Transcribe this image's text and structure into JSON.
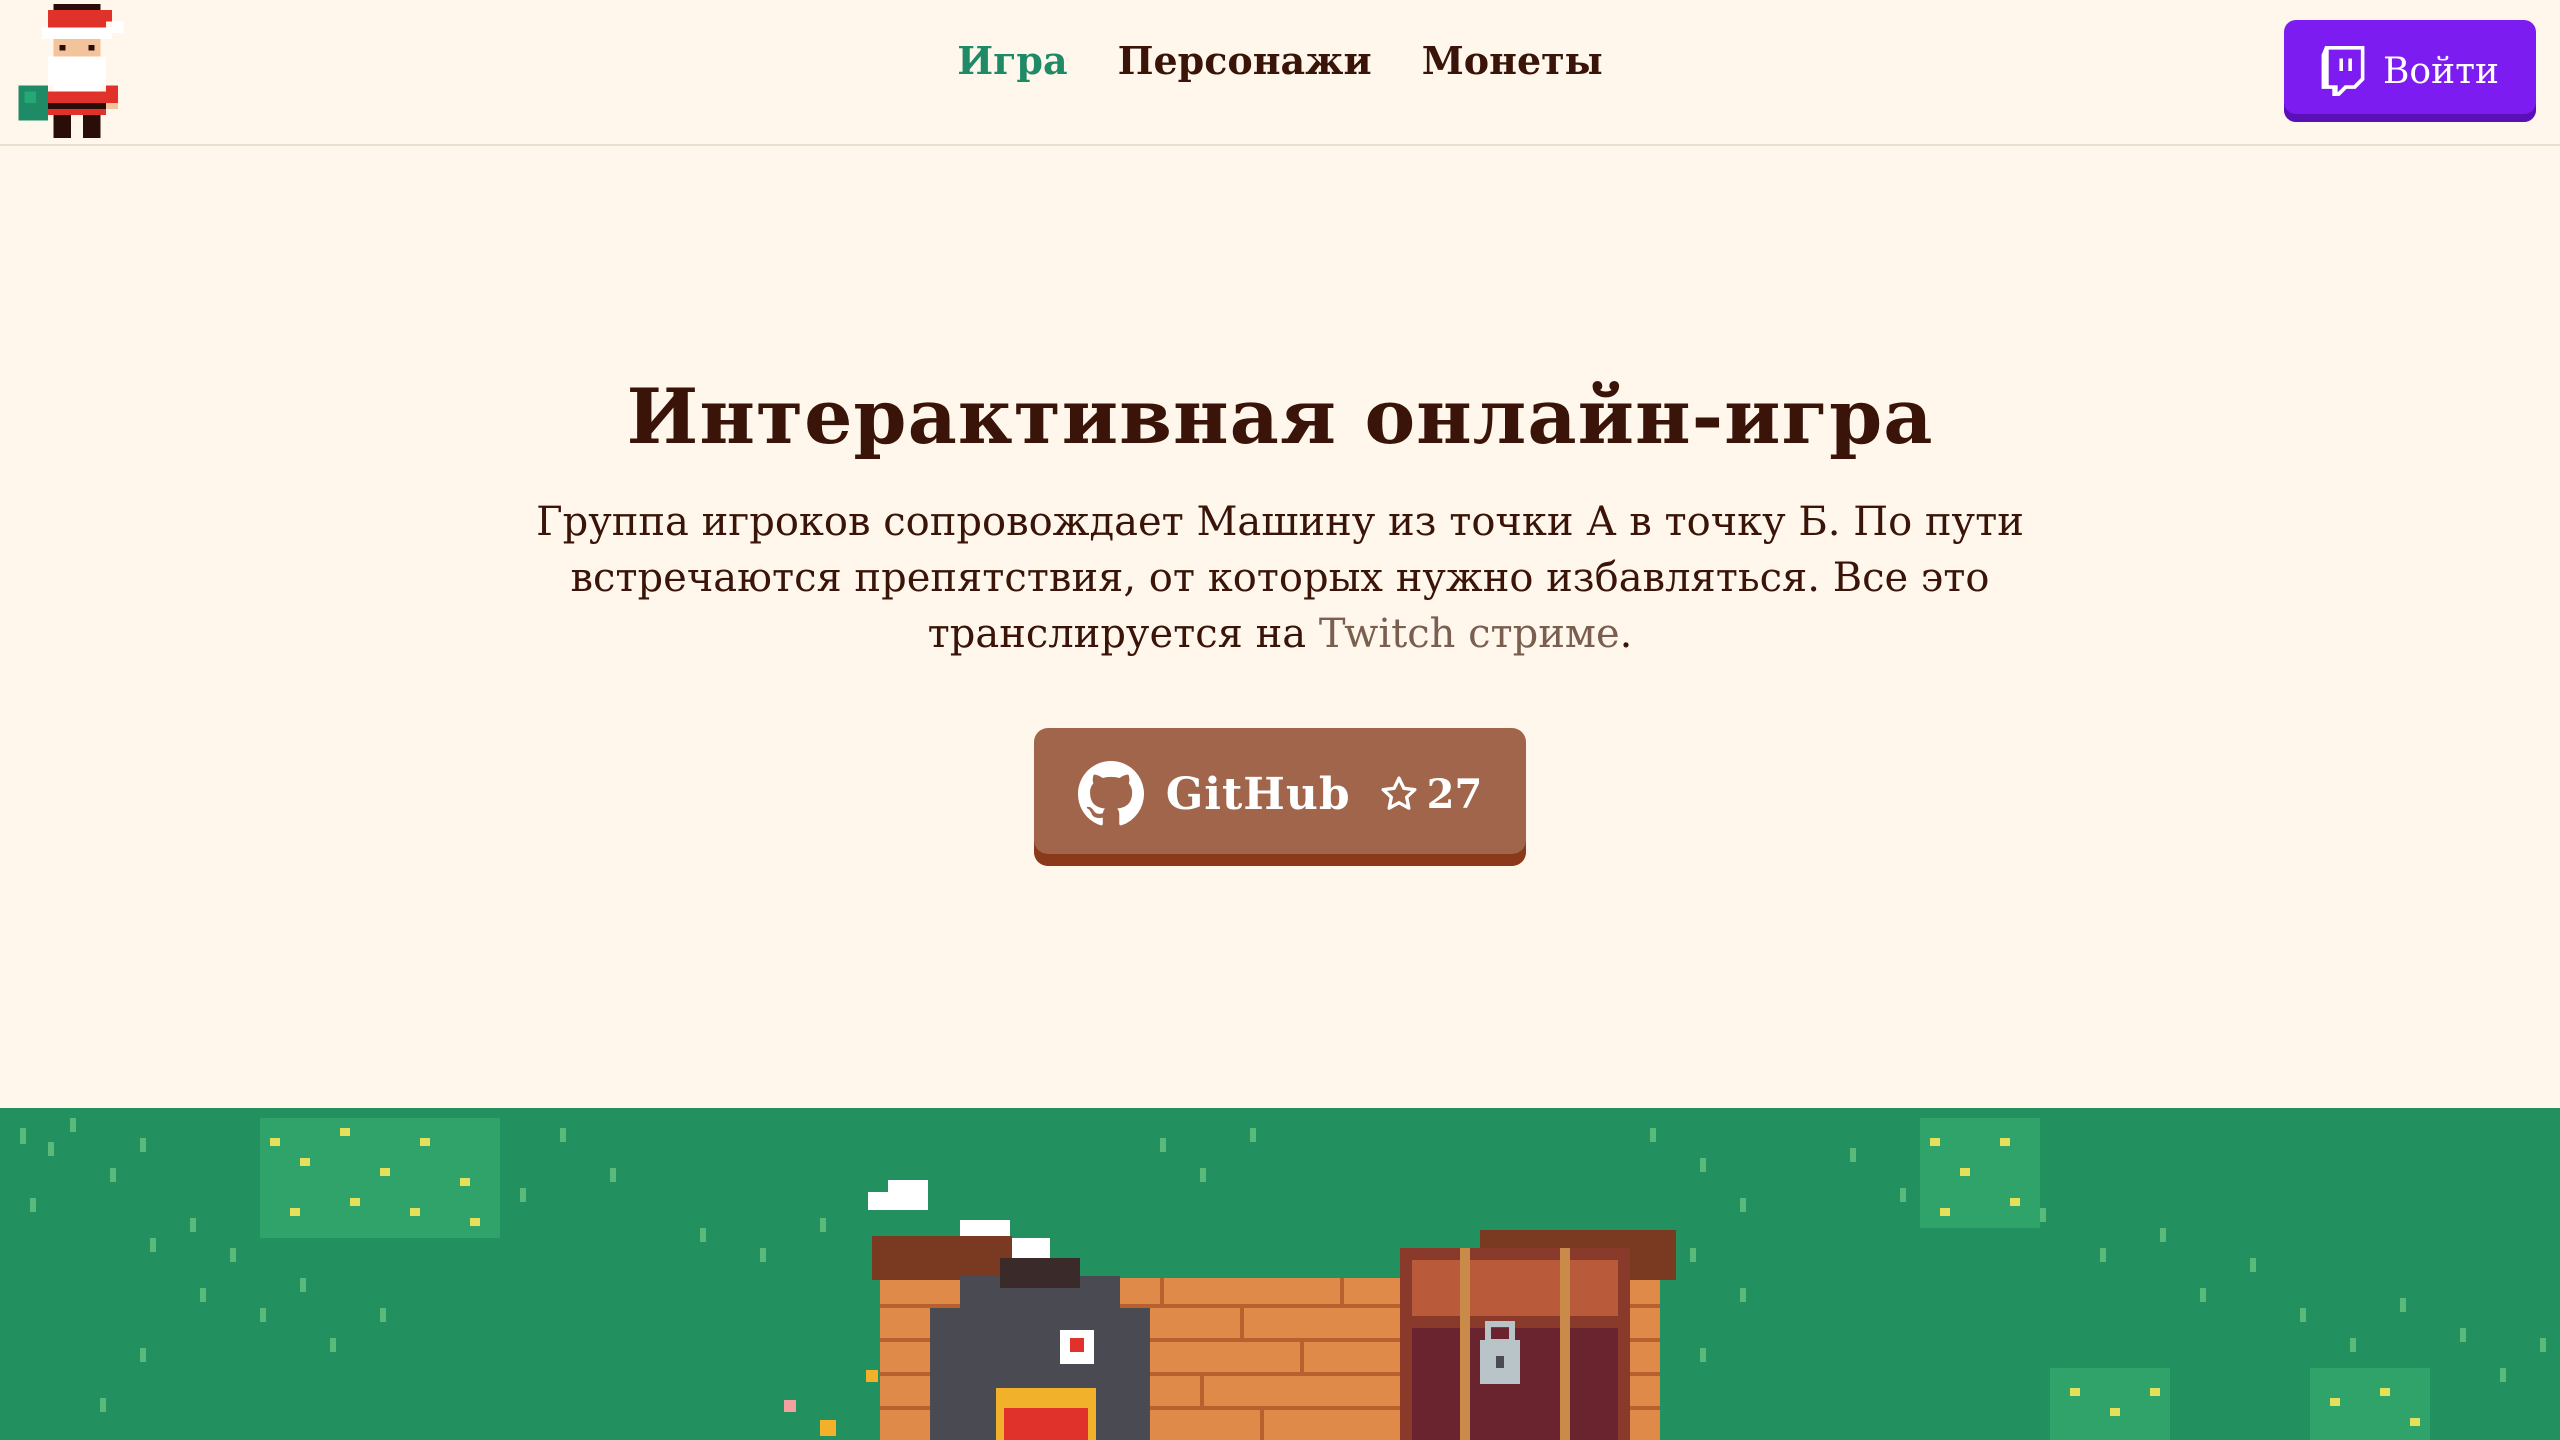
{
  "header": {
    "logo_icon": "santa-pixel-logo-icon",
    "nav": [
      {
        "label": "Игра",
        "active": true
      },
      {
        "label": "Персонажи",
        "active": false
      },
      {
        "label": "Монеты",
        "active": false
      }
    ],
    "login_label": "Войти",
    "login_icon": "twitch-icon"
  },
  "hero": {
    "title": "Интерактивная онлайн-игра",
    "text_before_link": "Группа игроков сопровождает Машину из точки А в точку Б. По пути встречаются препятствия, от которых нужно избавляться. Все это транслируется на ",
    "link_text": "Twitch стриме",
    "text_after_link": "."
  },
  "github_button": {
    "label": "GitHub",
    "stars": "27",
    "icon": "github-icon",
    "star_icon": "star-icon"
  },
  "colors": {
    "background": "#fff7ec",
    "accent_green": "#1f8a66",
    "twitch_purple": "#7c1cf0",
    "github_brown": "#a0654a",
    "grass": "#22915f"
  }
}
